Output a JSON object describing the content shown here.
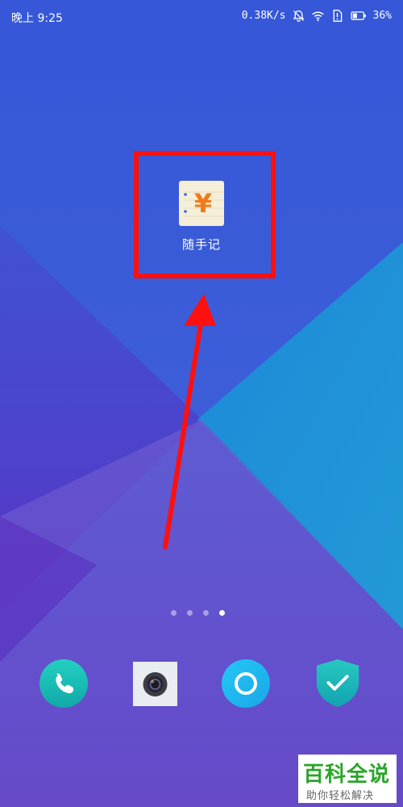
{
  "status_bar": {
    "time": "晚上 9:25",
    "network_speed": "0.38K/s",
    "battery": "36%",
    "icons": [
      "alarm-off-icon",
      "wifi-icon",
      "sim-alert-icon",
      "battery-icon"
    ]
  },
  "home": {
    "app": {
      "name": "随手记",
      "icon": "yuan-notebook-icon",
      "icon_glyph": "¥"
    },
    "page_indicator": {
      "total": 4,
      "current": 4
    }
  },
  "dock": [
    {
      "name": "phone",
      "icon": "phone-icon"
    },
    {
      "name": "camera",
      "icon": "camera-icon"
    },
    {
      "name": "browser",
      "icon": "browser-icon"
    },
    {
      "name": "security",
      "icon": "shield-check-icon"
    }
  ],
  "watermark": {
    "title": "百科全说",
    "subtitle": "助你轻松解决"
  },
  "colors": {
    "highlight": "#ff1010",
    "watermark_green": "#2aa52a",
    "phone_teal": "#19c0b4",
    "browser_cyan": "#1cb8f0"
  }
}
